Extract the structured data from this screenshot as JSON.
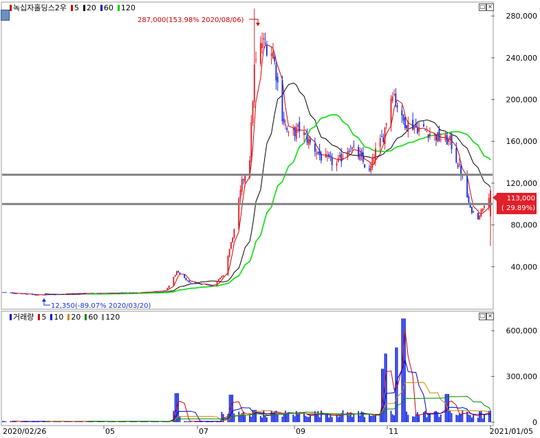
{
  "price_panel": {
    "legend": [
      {
        "text": "녹십자홀딩스2우",
        "color": "#000000",
        "marker_color": "#cc0000"
      },
      {
        "text": "5",
        "color": "#000000",
        "marker_color": "#cc0000"
      },
      {
        "text": "20",
        "color": "#000000",
        "marker_color": "#000000"
      },
      {
        "text": "60",
        "color": "#000000",
        "marker_color": "#0000cc"
      },
      {
        "text": "120",
        "color": "#000000",
        "marker_color": "#00cc00"
      }
    ],
    "max_label": "287,000(153.98% 2020/08/06)",
    "min_label": "12,350(-89.07% 2020/03/20)",
    "current_price_label": "113,000",
    "current_pct_label": "( 29.89%)",
    "y_ticks": [
      "280,000",
      "240,000",
      "200,000",
      "160,000",
      "120,000",
      "80,000",
      "40,000"
    ],
    "y_tick_values": [
      280000,
      240000,
      200000,
      160000,
      120000,
      80000,
      40000
    ],
    "ylim": [
      0,
      290000
    ]
  },
  "volume_panel": {
    "legend": [
      {
        "text": "거래량",
        "color": "#000000",
        "marker_color": "#0000cc"
      },
      {
        "text": "5",
        "color": "#000000",
        "marker_color": "#cc0000"
      },
      {
        "text": "10",
        "color": "#000000",
        "marker_color": "#0000cc"
      },
      {
        "text": "20",
        "color": "#000000",
        "marker_color": "#cc8800"
      },
      {
        "text": "60",
        "color": "#000000",
        "marker_color": "#008800"
      },
      {
        "text": "120",
        "color": "#000000",
        "marker_color": "#888888"
      }
    ],
    "y_ticks": [
      "600,000",
      "300,000",
      "0"
    ],
    "y_tick_values": [
      600000,
      300000,
      0
    ],
    "ylim": [
      0,
      700000
    ]
  },
  "x_axis": {
    "labels": [
      "2020/02/26",
      "05",
      "07",
      "09",
      "11",
      "2021/01/05"
    ]
  },
  "colors": {
    "up": "#e0202a",
    "down": "#1a2ee0",
    "ma5": "#cc0000",
    "ma20": "#000000",
    "ma60": "#1010c0",
    "ma120": "#22dd22",
    "hline": "#808080"
  },
  "chart_data": {
    "type": "candlestick",
    "title": "녹십자홀딩스2우",
    "x_range": [
      "2020/02/26",
      "2021/01/05"
    ],
    "price_ylim": [
      0,
      290000
    ],
    "volume_ylim": [
      0,
      700000
    ],
    "horizontal_lines": [
      128000,
      100000
    ],
    "max": {
      "value": 287000,
      "pct": "153.98%",
      "date": "2020/08/06"
    },
    "min": {
      "value": 12350,
      "pct": "-89.07%",
      "date": "2020/03/20"
    },
    "last_close": 113000,
    "last_change_pct": "29.89%",
    "price_anchors": [
      {
        "date": "2020-02-26",
        "close": 15500
      },
      {
        "date": "2020-03-20",
        "close": 13000
      },
      {
        "date": "2020-04-15",
        "close": 14500
      },
      {
        "date": "2020-05-20",
        "close": 15000
      },
      {
        "date": "2020-06-10",
        "close": 17000
      },
      {
        "date": "2020-06-17",
        "close": 35000
      },
      {
        "date": "2020-06-25",
        "close": 25000
      },
      {
        "date": "2020-07-10",
        "close": 22000
      },
      {
        "date": "2020-07-17",
        "close": 32000
      },
      {
        "date": "2020-07-24",
        "close": 75000
      },
      {
        "date": "2020-07-29",
        "close": 120000
      },
      {
        "date": "2020-08-03",
        "close": 145000
      },
      {
        "date": "2020-08-06",
        "close": 230000
      },
      {
        "date": "2020-08-11",
        "close": 255000
      },
      {
        "date": "2020-08-18",
        "close": 245000
      },
      {
        "date": "2020-08-24",
        "close": 185000
      },
      {
        "date": "2020-08-28",
        "close": 165000
      },
      {
        "date": "2020-09-04",
        "close": 172000
      },
      {
        "date": "2020-09-10",
        "close": 160000
      },
      {
        "date": "2020-09-18",
        "close": 145000
      },
      {
        "date": "2020-09-28",
        "close": 138000
      },
      {
        "date": "2020-10-06",
        "close": 155000
      },
      {
        "date": "2020-10-13",
        "close": 145000
      },
      {
        "date": "2020-10-19",
        "close": 130000
      },
      {
        "date": "2020-10-23",
        "close": 150000
      },
      {
        "date": "2020-10-28",
        "close": 165000
      },
      {
        "date": "2020-11-03",
        "close": 210000
      },
      {
        "date": "2020-11-09",
        "close": 180000
      },
      {
        "date": "2020-11-16",
        "close": 175000
      },
      {
        "date": "2020-11-25",
        "close": 170000
      },
      {
        "date": "2020-12-03",
        "close": 163000
      },
      {
        "date": "2020-12-10",
        "close": 160000
      },
      {
        "date": "2020-12-17",
        "close": 130000
      },
      {
        "date": "2020-12-23",
        "close": 95000
      },
      {
        "date": "2020-12-28",
        "close": 87000
      },
      {
        "date": "2021-01-05",
        "close": 113000
      }
    ],
    "volume_spikes": [
      {
        "date": "2020-06-17",
        "value": 190000
      },
      {
        "date": "2020-07-22",
        "value": 180000
      },
      {
        "date": "2020-08-06",
        "value": 80000
      },
      {
        "date": "2020-10-28",
        "value": 350000
      },
      {
        "date": "2020-10-30",
        "value": 450000
      },
      {
        "date": "2020-11-06",
        "value": 490000
      },
      {
        "date": "2020-11-10",
        "value": 680000
      },
      {
        "date": "2020-12-08",
        "value": 185000
      }
    ]
  }
}
